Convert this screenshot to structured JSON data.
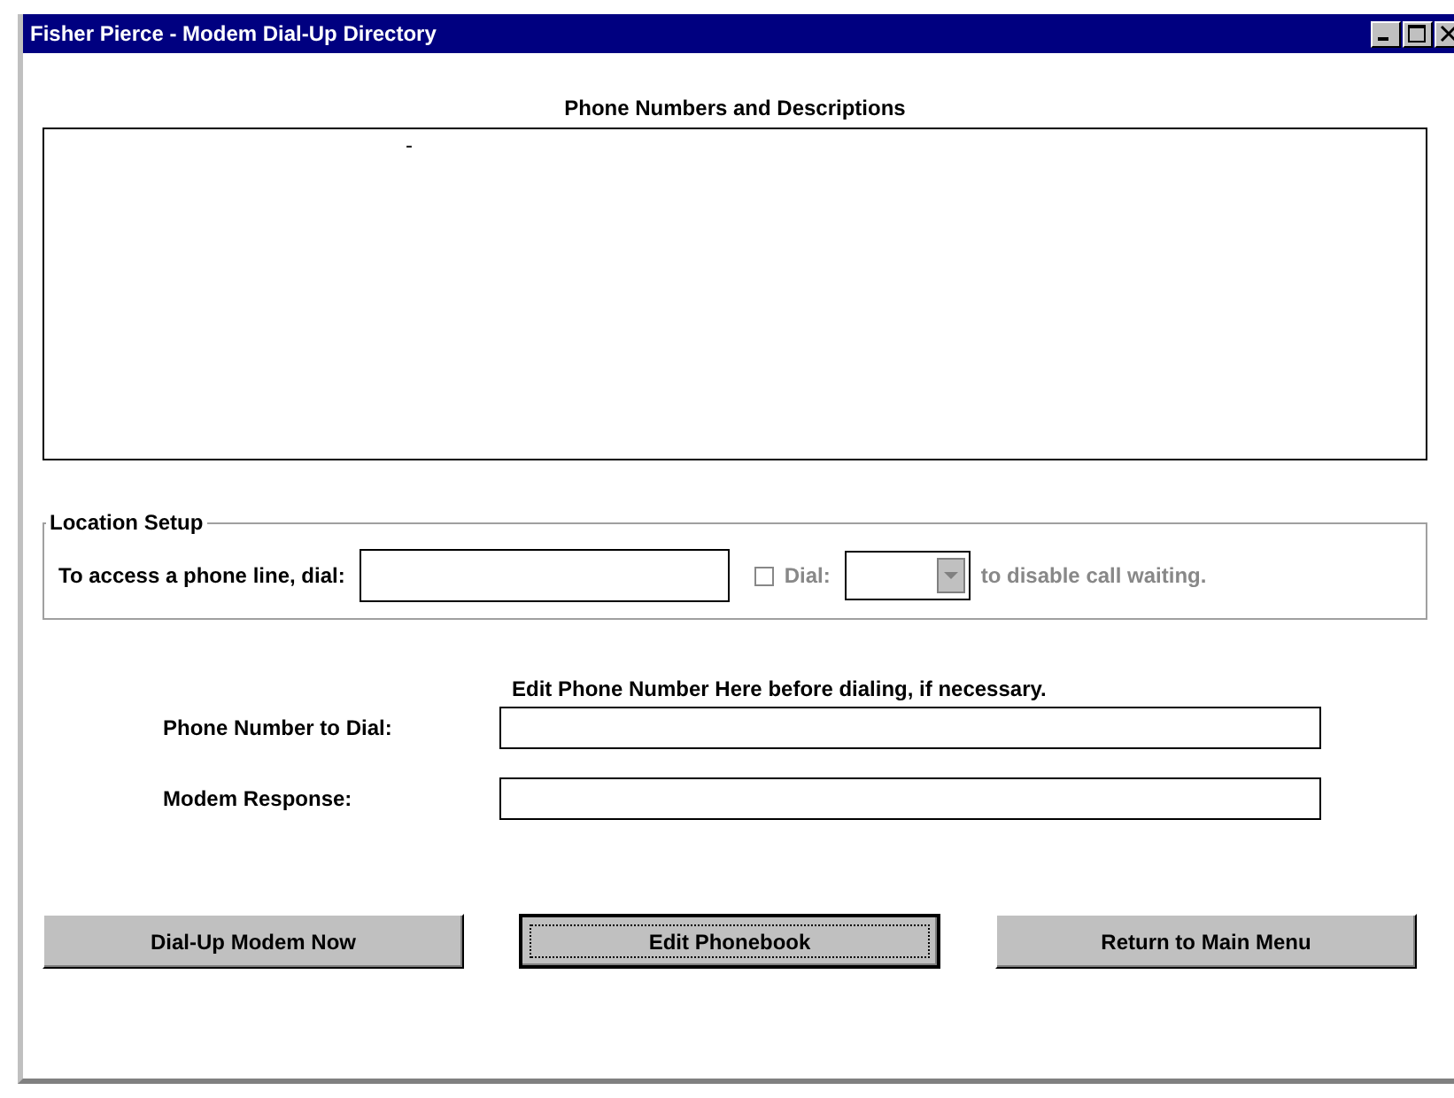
{
  "window": {
    "title": "Fisher Pierce - Modem Dial-Up Directory"
  },
  "phone_list": {
    "heading": "Phone Numbers and Descriptions",
    "items": [
      "-"
    ]
  },
  "location_setup": {
    "legend": "Location Setup",
    "access_label": "To access a phone line, dial:",
    "dial_checkbox": {
      "label": "Dial:",
      "checked": false,
      "disabled": true
    },
    "disable_waiting_label": "to disable call waiting."
  },
  "edit_hint": "Edit Phone Number Here before dialing, if necessary.",
  "fields": [
    {
      "label": "Phone Number to Dial:"
    },
    {
      "label": "Modem Response:"
    }
  ],
  "buttons": [
    {
      "label": "Dial-Up Modem Now",
      "focused": false
    },
    {
      "label": "Edit Phonebook",
      "focused": true
    },
    {
      "label": "Return to Main Menu",
      "focused": false
    }
  ]
}
